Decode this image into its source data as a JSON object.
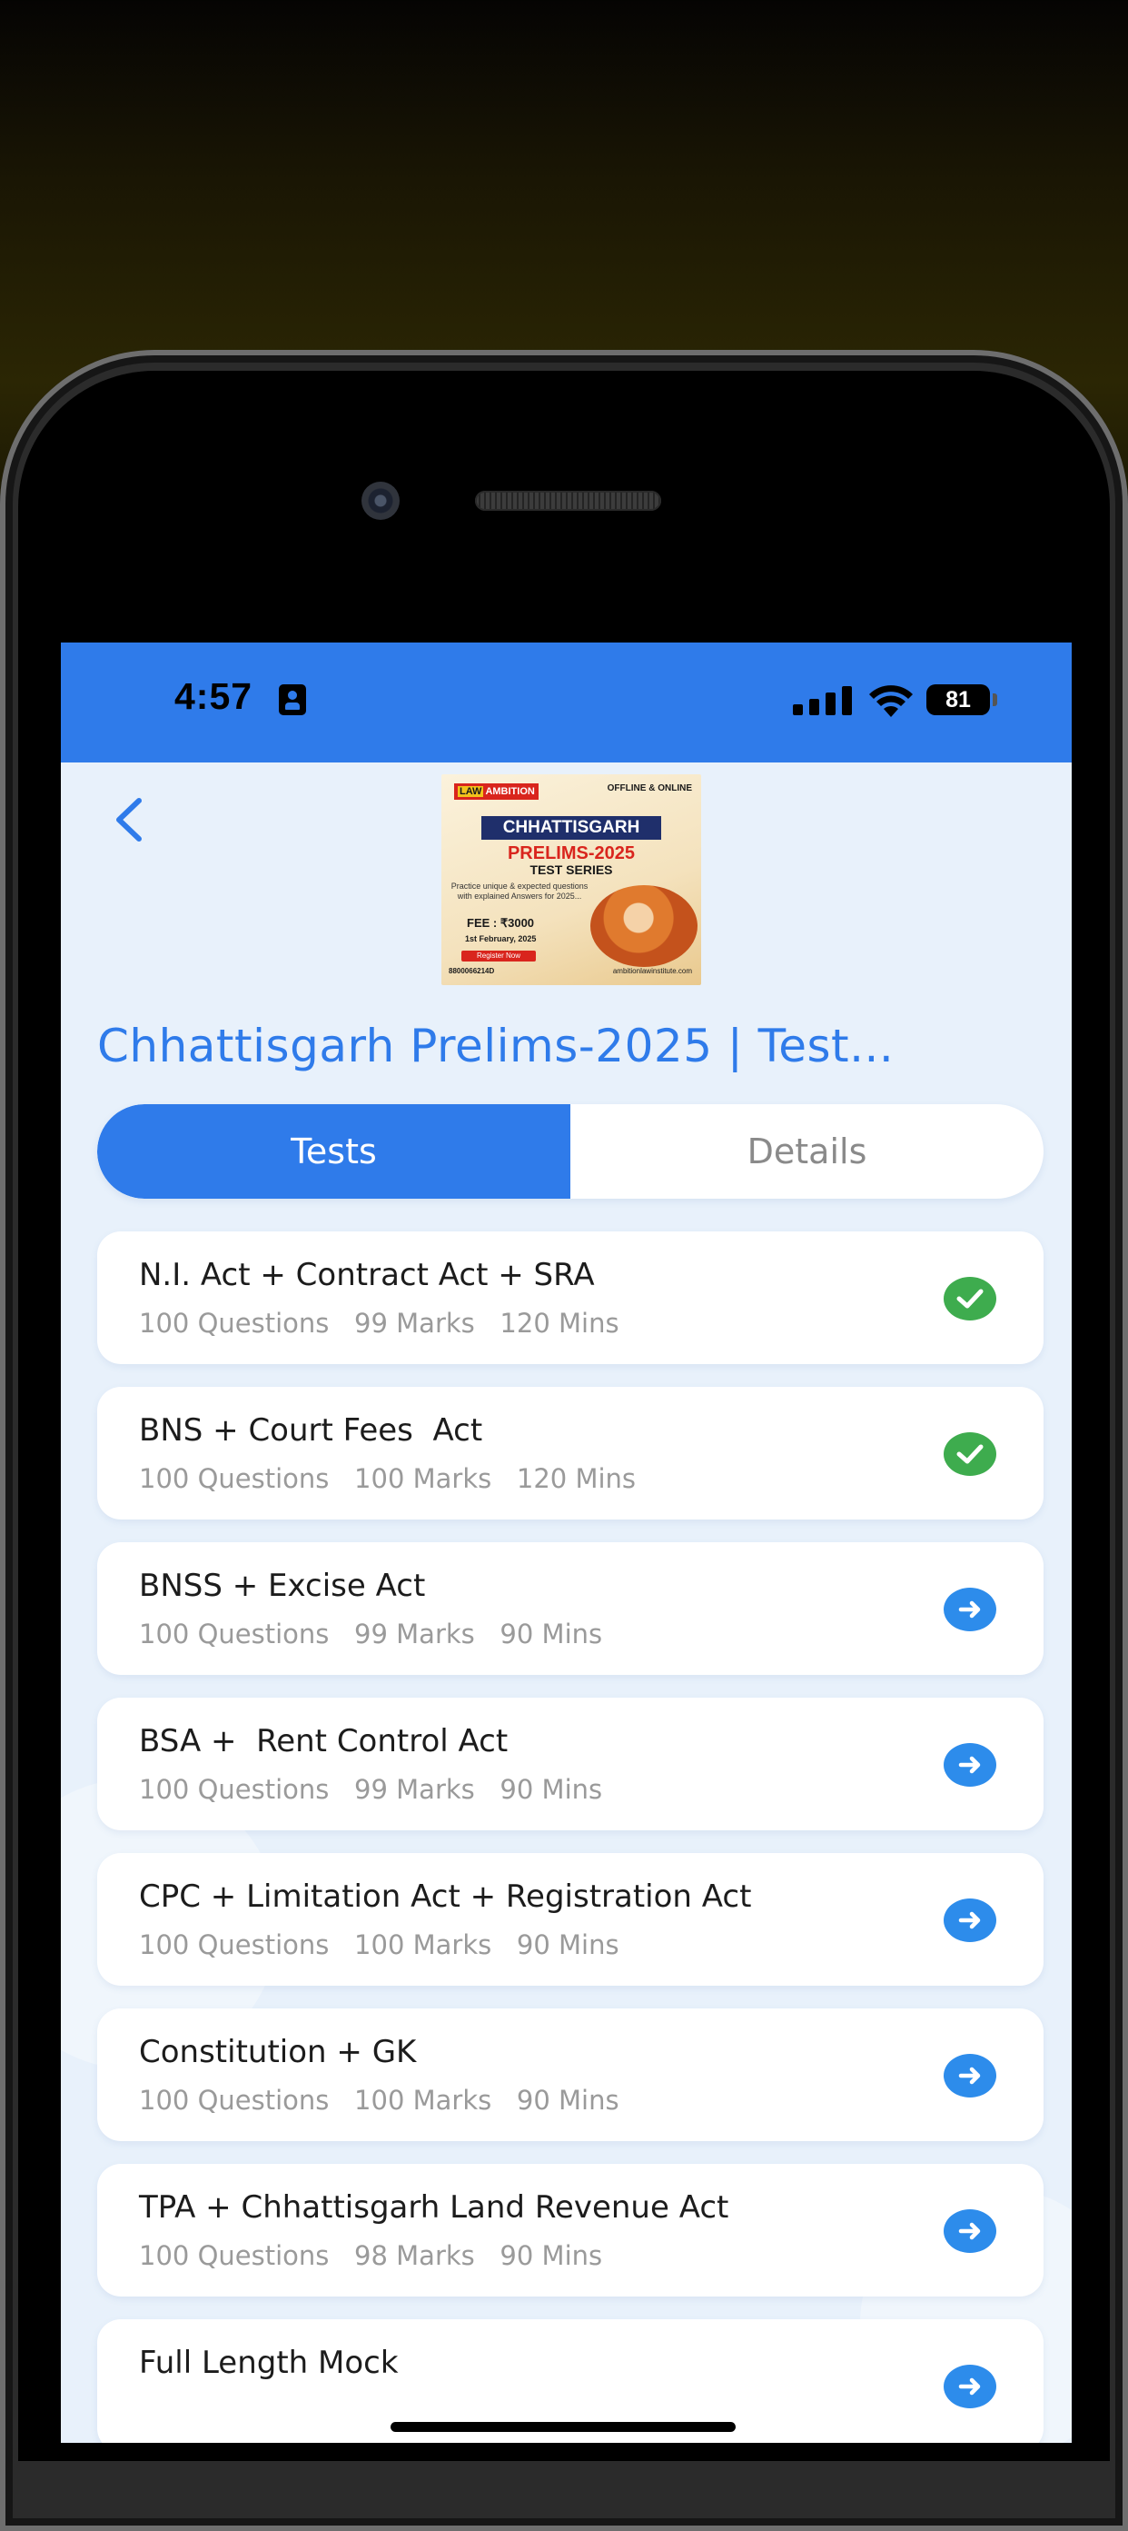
{
  "status_bar": {
    "time": "4:57",
    "battery": "81"
  },
  "banner": {
    "logo_law": "LAW",
    "logo_name": "AMBITION",
    "mode": "OFFLINE & ONLINE",
    "title": "CHHATTISGARH",
    "subtitle": "PRELIMS-2025",
    "series": "TEST SERIES",
    "tagline": "Practice unique & expected questions with explained Answers for 2025...",
    "fee": "FEE : ₹3000",
    "date": "1st February, 2025",
    "register": "Register Now",
    "phone": "8800066214D",
    "website": "ambitionlawinstitute.com"
  },
  "page": {
    "title": "Chhattisgarh Prelims-2025 | Test..."
  },
  "tabs": {
    "tests": "Tests",
    "details": "Details"
  },
  "tests": [
    {
      "title": "N.I. Act + Contract Act + SRA",
      "meta": "100 Questions   99 Marks   120 Mins",
      "status": "completed"
    },
    {
      "title": "BNS + Court Fees  Act",
      "meta": "100 Questions   100 Marks   120 Mins",
      "status": "completed"
    },
    {
      "title": "BNSS + Excise Act",
      "meta": "100 Questions   99 Marks   90 Mins",
      "status": "start"
    },
    {
      "title": "BSA +  Rent Control Act",
      "meta": "100 Questions   99 Marks   90 Mins",
      "status": "start"
    },
    {
      "title": "CPC + Limitation Act + Registration Act",
      "meta": "100 Questions   100 Marks   90 Mins",
      "status": "start"
    },
    {
      "title": "Constitution + GK",
      "meta": "100 Questions   100 Marks   90 Mins",
      "status": "start"
    },
    {
      "title": "TPA + Chhattisgarh Land Revenue Act",
      "meta": "100 Questions   98 Marks   90 Mins",
      "status": "start"
    },
    {
      "title": "Full Length Mock",
      "meta": "",
      "status": "start"
    }
  ],
  "icons": {
    "back": "chevron-left-icon",
    "done": "check-circle-icon",
    "start": "arrow-right-circle-icon"
  },
  "colors": {
    "primary": "#2f7bea",
    "success": "#3eac4e",
    "action": "#2d8ceb",
    "background": "#e8f1fb"
  }
}
